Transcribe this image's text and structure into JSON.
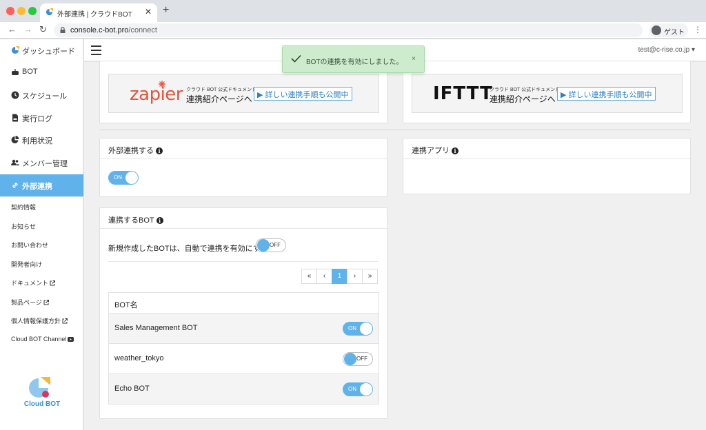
{
  "browser": {
    "tab_title": "外部連携 | クラウドBOT",
    "tab_close": "✕",
    "new_tab": "+",
    "url_domain": "console.c-bot.pro",
    "url_path": "/connect",
    "profile_label": "ゲスト",
    "back": "←",
    "forward": "→",
    "reload": "↻",
    "menu": "⋮"
  },
  "sidebar": {
    "items": [
      {
        "label": "ダッシュボード",
        "icon": "dashboard-icon"
      },
      {
        "label": "BOT",
        "icon": "robot-icon"
      },
      {
        "label": "スケジュール",
        "icon": "clock-icon"
      },
      {
        "label": "実行ログ",
        "icon": "file-icon"
      },
      {
        "label": "利用状況",
        "icon": "pie-chart-icon"
      },
      {
        "label": "メンバー管理",
        "icon": "users-icon"
      },
      {
        "label": "外部連携",
        "icon": "link-icon",
        "active": true
      }
    ],
    "links": [
      "契約情報",
      "お知らせ",
      "お問い合わせ",
      "開発者向け",
      "ドキュメント",
      "製品ページ",
      "個人情報保護方針",
      "Cloud BOT Channel"
    ],
    "logo_text": "Cloud BOT"
  },
  "header": {
    "user": "test@c-rise.co.jp ▾"
  },
  "banners": {
    "zapier": {
      "brand": "zapier",
      "small": "クラウド BOT 公式ドキュメント",
      "big": "連携紹介ページへ",
      "button": "▶ 詳しい連携手順も公開中"
    },
    "ifttt": {
      "brand": "IFTTT",
      "small": "クラウド BOT 公式ドキュメント",
      "big": "連携紹介ページへ",
      "button": "▶ 詳しい連携手順も公開中"
    }
  },
  "external_card": {
    "title": "外部連携する",
    "toggle_label": "ON",
    "enabled": true
  },
  "apps_card": {
    "title": "連携アプリ"
  },
  "bots_card": {
    "title": "連携するBOT",
    "auto_text": "新規作成したBOTは、自動で連携を有効にする",
    "auto_toggle": "OFF",
    "pager": [
      "«",
      "‹",
      "1",
      "›",
      "»"
    ],
    "column": "BOT名",
    "rows": [
      {
        "name": "Sales Management BOT",
        "state": "ON"
      },
      {
        "name": "weather_tokyo",
        "state": "OFF"
      },
      {
        "name": "Echo BOT",
        "state": "ON"
      }
    ]
  },
  "toast": {
    "message": "BOTの連携を有効にしました。",
    "close": "×"
  },
  "colors": {
    "accent": "#5fb3ea",
    "toast_bg": "#cdeccd",
    "zapier": "#e3543c"
  }
}
